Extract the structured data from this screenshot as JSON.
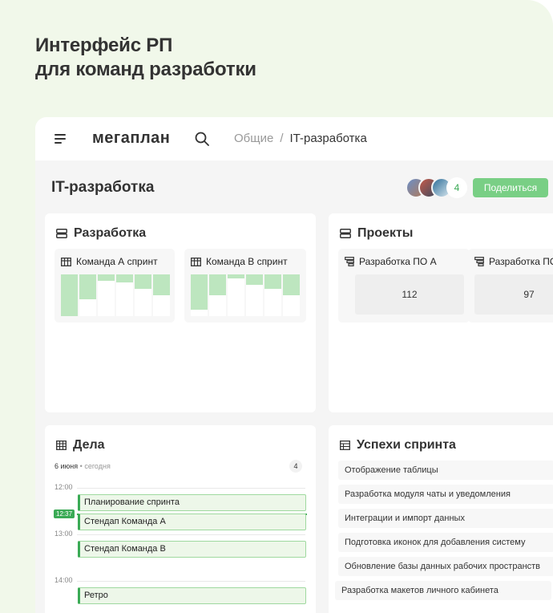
{
  "hero": {
    "line1": "Интерфейс РП",
    "line2": "для команд разработки"
  },
  "topbar": {
    "logo": "мегаплан",
    "crumbs": [
      "Общие",
      "IT-разработка"
    ],
    "separator": "/"
  },
  "page": {
    "title": "IT-разработка",
    "members_extra": "4",
    "share_label": "Поделиться"
  },
  "dev_widget": {
    "title": "Разработка",
    "sprints": [
      {
        "title": "Команда А спринт",
        "fill_levels": [
          1.0,
          0.6,
          0.15,
          0.2,
          0.35,
          0.5
        ]
      },
      {
        "title": "Команда В спринт",
        "fill_levels": [
          0.85,
          0.5,
          0.1,
          0.25,
          0.35,
          0.5
        ]
      }
    ]
  },
  "projects_widget": {
    "title": "Проекты",
    "items": [
      {
        "title": "Разработка ПО А",
        "value": "112"
      },
      {
        "title": "Разработка ПО",
        "value": "97"
      }
    ]
  },
  "tasks_widget": {
    "title": "Дела",
    "date": "6 июня",
    "date_sep": "•",
    "date_rel": "сегодня",
    "count": "4",
    "times": [
      "12:00",
      "13:00",
      "14:00"
    ],
    "now_time": "12:37",
    "events": [
      "Планирование спринта",
      "Стендап Команда А",
      "Стендап Команда В",
      "Ретро"
    ]
  },
  "success_widget": {
    "title": "Успехи спринта",
    "items": [
      "Отображение таблицы",
      "Разработка модуля чаты и уведомления",
      "Интеграции и импорт данных",
      "Подготовка иконок для добавления систему",
      "Обновление базы данных рабочих пространств",
      "Разработка макетов личного кабинета"
    ]
  },
  "colors": {
    "accent": "#3aaa55",
    "button": "#79cf85",
    "bar_fill": "#bde6bf",
    "hero_bg": "#f1f8ea"
  }
}
